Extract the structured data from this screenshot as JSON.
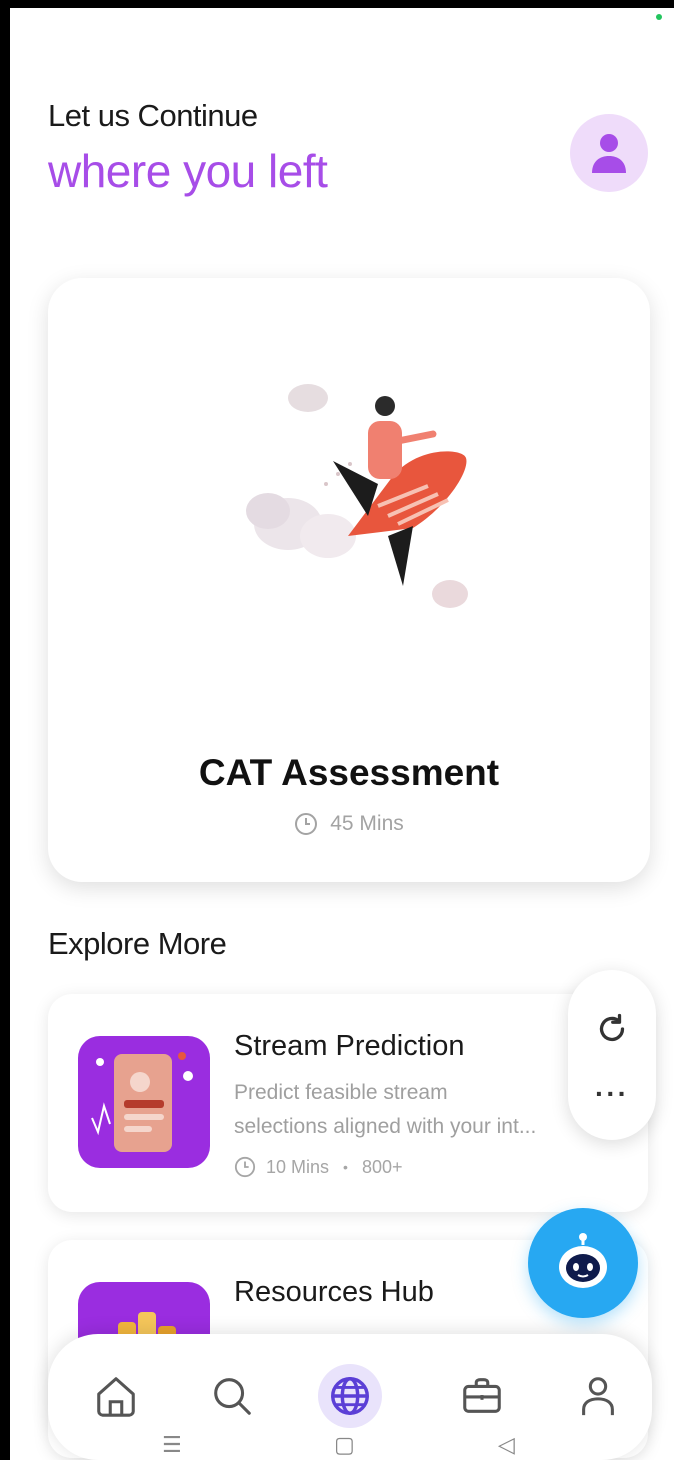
{
  "header": {
    "greeting": "Let us Continue",
    "highlight": "where you left",
    "avatar_icon": "user-icon",
    "accent_color": "#a74de8"
  },
  "featured": {
    "title": "CAT Assessment",
    "duration": "45 Mins",
    "clock_icon": "clock-icon"
  },
  "explore": {
    "title": "Explore More",
    "items": [
      {
        "title": "Stream Prediction",
        "desc_line1": "Predict feasible stream",
        "desc_line2": "selections aligned with your int...",
        "duration": "10 Mins",
        "count": "800+"
      },
      {
        "title": "Resources Hub"
      }
    ]
  },
  "side_actions": [
    "refresh-icon",
    "more-icon"
  ],
  "assistant": {
    "icon": "bot-icon",
    "color": "#27a8f2"
  },
  "bottom_nav": {
    "items": [
      "home-icon",
      "search-icon",
      "globe-icon",
      "briefcase-icon",
      "profile-icon"
    ],
    "active": "globe-icon",
    "active_color": "#5b3fd6"
  }
}
